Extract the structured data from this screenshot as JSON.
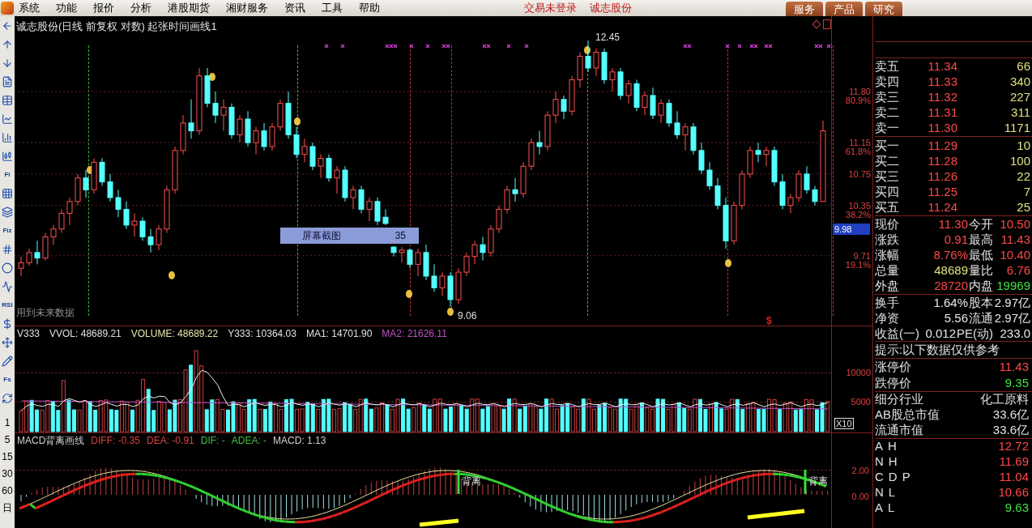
{
  "menu_bar": {
    "items": [
      "系统",
      "功能",
      "报价",
      "分析",
      "港股期货",
      "湘财服务",
      "资讯",
      "工具",
      "帮助"
    ],
    "status": [
      "交易未登录",
      "诚志股份"
    ],
    "buttons": [
      "服务",
      "产品",
      "研究"
    ]
  },
  "toolbar": {
    "items": [
      {
        "kind": "icon"
      },
      {
        "kind": "icon"
      },
      {
        "kind": "icon"
      },
      {
        "kind": "icon"
      },
      {
        "kind": "icon"
      },
      {
        "kind": "icon"
      },
      {
        "kind": "icon"
      },
      {
        "kind": "icon"
      },
      {
        "kind": "label",
        "text": "Fi"
      },
      {
        "kind": "icon"
      },
      {
        "kind": "icon"
      },
      {
        "kind": "label",
        "text": "Fiz"
      },
      {
        "kind": "icon"
      },
      {
        "kind": "icon"
      },
      {
        "kind": "icon"
      },
      {
        "kind": "label",
        "text": "RSI"
      },
      {
        "kind": "icon"
      },
      {
        "kind": "icon"
      },
      {
        "kind": "icon"
      },
      {
        "kind": "label",
        "text": "Fs"
      },
      {
        "kind": "icon"
      }
    ],
    "periods": [
      "1",
      "5",
      "15",
      "30",
      "60",
      "日"
    ]
  },
  "price_chart": {
    "title": "诚志股份(日线 前复权 对数) 起张时间画线1",
    "chart_data": {
      "type": "candlestick",
      "ohlc": [
        [
          9.55,
          9.7,
          9.45,
          9.62
        ],
        [
          9.62,
          9.8,
          9.58,
          9.75
        ],
        [
          9.75,
          9.9,
          9.6,
          9.68
        ],
        [
          9.68,
          10.0,
          9.65,
          9.95
        ],
        [
          9.95,
          10.1,
          9.85,
          10.05
        ],
        [
          10.05,
          10.3,
          10.0,
          10.25
        ],
        [
          10.25,
          10.45,
          10.1,
          10.4
        ],
        [
          10.4,
          10.75,
          10.35,
          10.7
        ],
        [
          10.7,
          10.8,
          10.45,
          10.55
        ],
        [
          10.55,
          10.95,
          10.5,
          10.9
        ],
        [
          10.9,
          10.95,
          10.6,
          10.65
        ],
        [
          10.65,
          10.75,
          10.4,
          10.45
        ],
        [
          10.45,
          10.55,
          10.2,
          10.3
        ],
        [
          10.3,
          10.4,
          10.05,
          10.1
        ],
        [
          10.1,
          10.25,
          9.95,
          10.15
        ],
        [
          10.15,
          10.2,
          9.9,
          9.95
        ],
        [
          9.95,
          10.05,
          9.75,
          9.85
        ],
        [
          9.85,
          10.1,
          9.78,
          10.05
        ],
        [
          10.05,
          10.6,
          10.0,
          10.55
        ],
        [
          10.55,
          11.1,
          10.5,
          11.05
        ],
        [
          11.05,
          11.5,
          11.0,
          11.4
        ],
        [
          11.4,
          11.7,
          11.2,
          11.3
        ],
        [
          11.3,
          12.1,
          11.25,
          12.0
        ],
        [
          12.0,
          12.1,
          11.6,
          11.65
        ],
        [
          11.65,
          11.8,
          11.4,
          11.5
        ],
        [
          11.5,
          11.7,
          11.3,
          11.6
        ],
        [
          11.6,
          11.65,
          11.2,
          11.25
        ],
        [
          11.25,
          11.5,
          11.15,
          11.45
        ],
        [
          11.45,
          11.55,
          11.1,
          11.15
        ],
        [
          11.15,
          11.35,
          11.0,
          11.3
        ],
        [
          11.3,
          11.4,
          11.05,
          11.1
        ],
        [
          11.1,
          11.4,
          11.05,
          11.35
        ],
        [
          11.35,
          11.7,
          11.3,
          11.65
        ],
        [
          11.65,
          11.8,
          11.2,
          11.25
        ],
        [
          11.25,
          11.35,
          10.95,
          11.0
        ],
        [
          11.0,
          11.2,
          10.9,
          11.1
        ],
        [
          11.1,
          11.15,
          10.8,
          10.85
        ],
        [
          10.85,
          11.0,
          10.7,
          10.95
        ],
        [
          10.95,
          11.0,
          10.65,
          10.7
        ],
        [
          10.7,
          10.85,
          10.5,
          10.8
        ],
        [
          10.8,
          10.85,
          10.4,
          10.45
        ],
        [
          10.45,
          10.6,
          10.3,
          10.55
        ],
        [
          10.55,
          10.6,
          10.25,
          10.3
        ],
        [
          10.3,
          10.45,
          10.15,
          10.4
        ],
        [
          10.4,
          10.45,
          10.1,
          10.15
        ],
        [
          10.2,
          10.3,
          10.1,
          10.12
        ],
        [
          9.82,
          9.83,
          9.7,
          9.75
        ],
        [
          9.75,
          9.82,
          9.62,
          9.78
        ],
        [
          9.78,
          9.8,
          9.55,
          9.6
        ],
        [
          9.6,
          9.8,
          9.45,
          9.75
        ],
        [
          9.75,
          9.85,
          9.4,
          9.45
        ],
        [
          9.45,
          9.6,
          9.25,
          9.3
        ],
        [
          9.3,
          9.5,
          9.2,
          9.45
        ],
        [
          9.45,
          9.5,
          9.06,
          9.15
        ],
        [
          9.15,
          9.55,
          9.1,
          9.5
        ],
        [
          9.5,
          9.75,
          9.45,
          9.7
        ],
        [
          9.7,
          9.9,
          9.6,
          9.85
        ],
        [
          9.85,
          9.95,
          9.65,
          9.75
        ],
        [
          9.75,
          10.1,
          9.7,
          10.05
        ],
        [
          10.05,
          10.35,
          10.0,
          10.3
        ],
        [
          10.3,
          10.6,
          10.25,
          10.55
        ],
        [
          10.55,
          10.7,
          10.4,
          10.5
        ],
        [
          10.5,
          10.9,
          10.45,
          10.85
        ],
        [
          10.85,
          11.2,
          10.8,
          11.15
        ],
        [
          11.15,
          11.3,
          11.0,
          11.1
        ],
        [
          11.1,
          11.55,
          11.05,
          11.5
        ],
        [
          11.5,
          11.8,
          11.4,
          11.7
        ],
        [
          11.7,
          11.75,
          11.45,
          11.55
        ],
        [
          11.55,
          12.0,
          11.5,
          11.95
        ],
        [
          11.95,
          12.3,
          11.85,
          12.25
        ],
        [
          12.25,
          12.45,
          12.05,
          12.1
        ],
        [
          12.1,
          12.35,
          12.0,
          12.3
        ],
        [
          12.3,
          12.35,
          11.9,
          11.95
        ],
        [
          11.95,
          12.1,
          11.8,
          12.05
        ],
        [
          12.05,
          12.1,
          11.7,
          11.75
        ],
        [
          11.75,
          11.95,
          11.65,
          11.9
        ],
        [
          11.9,
          11.95,
          11.55,
          11.6
        ],
        [
          11.6,
          11.8,
          11.5,
          11.75
        ],
        [
          11.75,
          11.85,
          11.45,
          11.5
        ],
        [
          11.5,
          11.7,
          11.4,
          11.65
        ],
        [
          11.65,
          11.7,
          11.35,
          11.4
        ],
        [
          11.4,
          11.55,
          11.2,
          11.25
        ],
        [
          11.25,
          11.4,
          11.05,
          11.35
        ],
        [
          11.35,
          11.4,
          11.0,
          11.05
        ],
        [
          11.05,
          11.15,
          10.75,
          10.8
        ],
        [
          10.8,
          10.9,
          10.55,
          10.6
        ],
        [
          10.6,
          10.7,
          10.3,
          10.35
        ],
        [
          10.35,
          10.45,
          9.8,
          9.9
        ],
        [
          9.9,
          10.4,
          9.85,
          10.35
        ],
        [
          10.35,
          10.8,
          10.3,
          10.75
        ],
        [
          10.75,
          11.1,
          10.7,
          11.05
        ],
        [
          11.05,
          11.15,
          10.9,
          11.0
        ],
        [
          11.0,
          11.1,
          10.85,
          11.05
        ],
        [
          11.05,
          11.1,
          10.6,
          10.65
        ],
        [
          10.65,
          10.75,
          10.3,
          10.35
        ],
        [
          10.35,
          10.5,
          10.25,
          10.45
        ],
        [
          10.45,
          10.8,
          10.4,
          10.75
        ],
        [
          10.75,
          10.85,
          10.5,
          10.55
        ],
        [
          10.55,
          10.6,
          10.35,
          10.4
        ],
        [
          10.4,
          11.43,
          10.4,
          11.3
        ]
      ],
      "ylim": [
        8.81,
        12.76
      ],
      "grid": true,
      "yticks": [
        {
          "value": 11.8,
          "label": "11.80"
        },
        {
          "value": 11.15,
          "label": "11.15"
        },
        {
          "value": 10.75,
          "label": "10.75"
        },
        {
          "value": 10.35,
          "label": "10.35"
        },
        {
          "value": 9.71,
          "label": "9.71"
        }
      ]
    },
    "fib_labels": [
      "80.9%",
      "61.8%",
      "38.2%",
      "19.1%"
    ],
    "current_price": "9.98",
    "high_label": "12.45",
    "low_label": "9.06",
    "tooltip": {
      "label": "屏幕截图",
      "value": "35"
    },
    "note": "用到未来数据",
    "marker": "$"
  },
  "volume_pane": {
    "indicators": [
      {
        "text": "V333",
        "color": "#e0e0e0"
      },
      {
        "text": "VVOL: 48689.21",
        "color": "#e0e0e0"
      },
      {
        "text": "VOLUME: 48689.22",
        "color": "#e8e8b0"
      },
      {
        "text": "Y333: 10364.03",
        "color": "#e0e0e0"
      },
      {
        "text": "MA1: 14701.90",
        "color": "#e0e0e0"
      },
      {
        "text": "MA2: 21626.11",
        "color": "#c050c8"
      }
    ],
    "axis_labels": [
      "10000",
      "5000"
    ],
    "scale": "X10"
  },
  "macd_pane": {
    "indicators": [
      {
        "text": "MACD背离画线",
        "color": "#d0d0d0"
      },
      {
        "text": "DIFF: -0.35",
        "color": "#e04040"
      },
      {
        "text": "DEA: -0.91",
        "color": "#e04040"
      },
      {
        "text": "DIF: -",
        "color": "#40c040"
      },
      {
        "text": "ADEA: -",
        "color": "#40c040"
      },
      {
        "text": "MACD: 1.13",
        "color": "#d0d0d0"
      }
    ],
    "axis_labels": [
      "2.00",
      "0.00"
    ],
    "divergence_labels": [
      "背离",
      "背离"
    ]
  },
  "quote_panel": {
    "sell": [
      {
        "label": "卖五",
        "price": "11.34",
        "volume": "66"
      },
      {
        "label": "卖四",
        "price": "11.33",
        "volume": "340"
      },
      {
        "label": "卖三",
        "price": "11.32",
        "volume": "227"
      },
      {
        "label": "卖二",
        "price": "11.31",
        "volume": "311"
      },
      {
        "label": "卖一",
        "price": "11.30",
        "volume": "1171"
      }
    ],
    "buy": [
      {
        "label": "买一",
        "price": "11.29",
        "volume": "10"
      },
      {
        "label": "买二",
        "price": "11.28",
        "volume": "100"
      },
      {
        "label": "买三",
        "price": "11.26",
        "volume": "22"
      },
      {
        "label": "买四",
        "price": "11.25",
        "volume": "7"
      },
      {
        "label": "买五",
        "price": "11.24",
        "volume": "25"
      }
    ],
    "trade_stats": [
      {
        "cells": [
          {
            "label": "现价",
            "value": "11.30",
            "color": "#ff4848"
          },
          {
            "label": "今开",
            "value": "10.50",
            "color": "#ff4848"
          }
        ]
      },
      {
        "cells": [
          {
            "label": "涨跌",
            "value": "0.91",
            "color": "#ff4848"
          },
          {
            "label": "最高",
            "value": "11.43",
            "color": "#ff4848"
          }
        ]
      },
      {
        "cells": [
          {
            "label": "涨幅",
            "value": "8.76%",
            "color": "#ff4848"
          },
          {
            "label": "最低",
            "value": "10.40",
            "color": "#ff4848"
          }
        ]
      },
      {
        "cells": [
          {
            "label": "总量",
            "value": "48689",
            "color": "#e0e080"
          },
          {
            "label": "量比",
            "value": "6.76",
            "color": "#ff4848"
          }
        ]
      },
      {
        "cells": [
          {
            "label": "外盘",
            "value": "28720",
            "color": "#ff4848"
          },
          {
            "label": "内盘",
            "value": "19969",
            "color": "#40e040"
          }
        ]
      }
    ],
    "share_stats": [
      {
        "cells": [
          {
            "label": "换手",
            "value": "1.64%",
            "color": "#e8e8e8"
          },
          {
            "label": "股本",
            "value": "2.97亿",
            "color": "#e8e8e8"
          }
        ]
      },
      {
        "cells": [
          {
            "label": "净资",
            "value": "5.56",
            "color": "#e8e8e8"
          },
          {
            "label": "流通",
            "value": "2.97亿",
            "color": "#e8e8e8"
          }
        ]
      },
      {
        "cells": [
          {
            "label": "收益(一)",
            "value": "0.012",
            "color": "#e8e8e8"
          },
          {
            "label": "PE(动)",
            "value": "233.0",
            "color": "#e8e8e8"
          }
        ]
      }
    ],
    "notice": "提示:以下数据仅供参考",
    "limits": [
      {
        "label": "涨停价",
        "value": "11.43",
        "color": "#ff4848"
      },
      {
        "label": "跌停价",
        "value": "9.35",
        "color": "#40e040"
      }
    ],
    "info": [
      {
        "label": "细分行业",
        "value": "化工原料"
      },
      {
        "label": "AB股总市值",
        "value": "33.6亿"
      },
      {
        "label": "流通市值",
        "value": "33.6亿"
      }
    ],
    "pivots": [
      {
        "label": "AH",
        "value": "12.72",
        "color": "#ff4848"
      },
      {
        "label": "NH",
        "value": "11.69",
        "color": "#ff4848"
      },
      {
        "label": "CDP",
        "value": "11.04",
        "color": "#ff4848"
      },
      {
        "label": "NL",
        "value": "10.66",
        "color": "#ff4848"
      },
      {
        "label": "AL",
        "value": "9.63",
        "color": "#40e040"
      }
    ]
  }
}
